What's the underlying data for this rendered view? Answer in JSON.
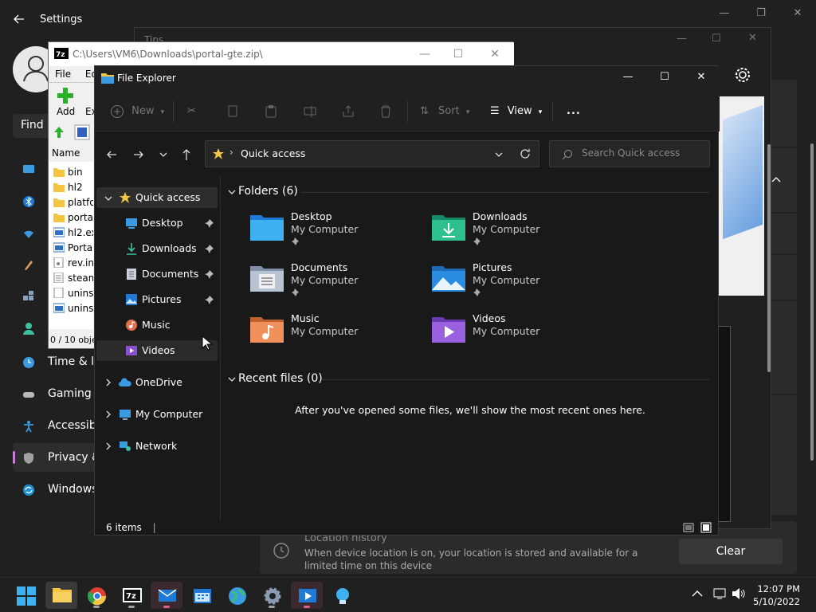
{
  "settings": {
    "title": "Settings",
    "find_placeholder": "Find a",
    "nav": [
      {
        "label": "Time & la",
        "icon": "clock-globe-icon"
      },
      {
        "label": "Gaming",
        "icon": "gamepad-icon"
      },
      {
        "label": "Accessibi",
        "icon": "accessibility-icon"
      },
      {
        "label": "Privacy &",
        "icon": "shield-icon"
      },
      {
        "label": "Windows",
        "icon": "windows-update-icon"
      }
    ],
    "location_history": {
      "title": "Location history",
      "desc": "When device location is on, your location is stored and available for a limited time on this device",
      "clear_label": "Clear"
    }
  },
  "tips": {
    "title": "Tips"
  },
  "sevenzip": {
    "title": "C:\\Users\\VM6\\Downloads\\portal-gte.zip\\",
    "menu": [
      "File",
      "Edit"
    ],
    "add_label": "Add",
    "ext_label": "Ex",
    "name_header": "Name",
    "rows": [
      {
        "name": "bin",
        "type": "folder"
      },
      {
        "name": "hl2",
        "type": "folder"
      },
      {
        "name": "platfor",
        "type": "folder"
      },
      {
        "name": "portal",
        "type": "folder"
      },
      {
        "name": "hl2.exe",
        "type": "exe"
      },
      {
        "name": "Portal.",
        "type": "exe"
      },
      {
        "name": "rev.ini",
        "type": "ini"
      },
      {
        "name": "steam_",
        "type": "file"
      },
      {
        "name": "unins0",
        "type": "file"
      },
      {
        "name": "unins0",
        "type": "exe"
      }
    ],
    "status": "0 / 10 obje"
  },
  "explorer": {
    "title": "File Explorer",
    "toolbar": {
      "new_label": "New",
      "sort_label": "Sort",
      "view_label": "View",
      "more_label": "..."
    },
    "address": {
      "path": "Quick access"
    },
    "search_placeholder": "Search Quick access",
    "nav": {
      "quick_access": "Quick access",
      "items": [
        {
          "label": "Desktop",
          "pinned": true
        },
        {
          "label": "Downloads",
          "pinned": true
        },
        {
          "label": "Documents",
          "pinned": true
        },
        {
          "label": "Pictures",
          "pinned": true
        },
        {
          "label": "Music",
          "pinned": false
        },
        {
          "label": "Videos",
          "pinned": false
        }
      ],
      "onedrive": "OneDrive",
      "my_computer": "My Computer",
      "network": "Network"
    },
    "folders_header": "Folders (6)",
    "folders": [
      {
        "name": "Desktop",
        "location": "My Computer",
        "pinned": true
      },
      {
        "name": "Downloads",
        "location": "My Computer",
        "pinned": true
      },
      {
        "name": "Documents",
        "location": "My Computer",
        "pinned": true
      },
      {
        "name": "Pictures",
        "location": "My Computer",
        "pinned": true
      },
      {
        "name": "Music",
        "location": "My Computer",
        "pinned": false
      },
      {
        "name": "Videos",
        "location": "My Computer",
        "pinned": false
      }
    ],
    "recent_header": "Recent files (0)",
    "recent_empty": "After you've opened some files, we'll show the most recent ones here.",
    "status": "6 items"
  },
  "taskbar": {
    "time": "12:07 PM",
    "date": "5/10/2022"
  }
}
